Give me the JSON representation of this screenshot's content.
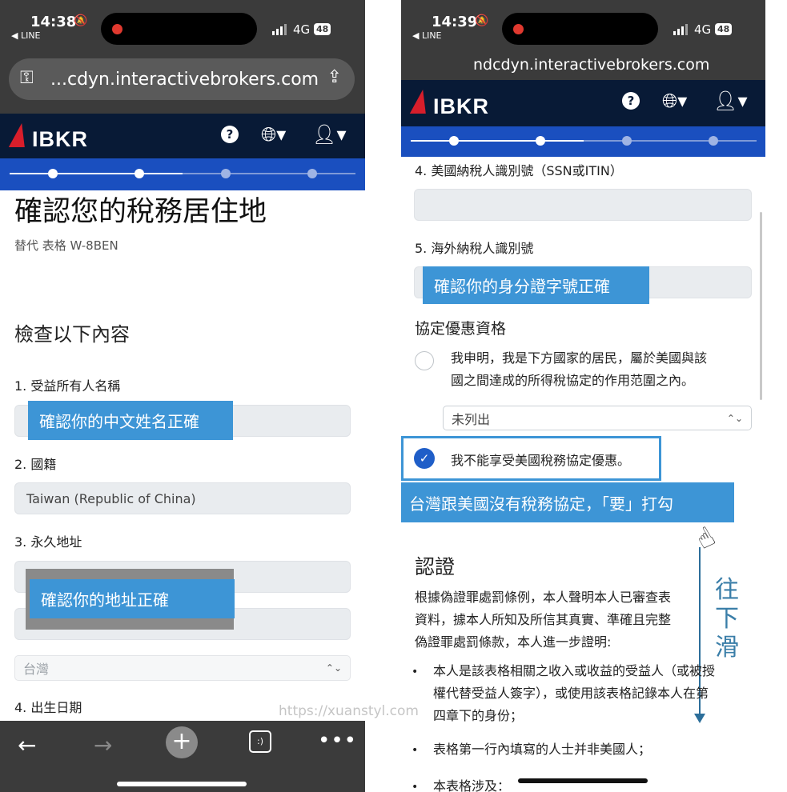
{
  "left": {
    "status": {
      "time": "14:38",
      "back_app": "◀ LINE",
      "network": "4G",
      "battery": "48"
    },
    "url": "...cdyn.interactivebrokers.com",
    "brand": "IBKR",
    "page_title": "確認您的稅務居住地",
    "page_subtitle": "替代 表格 W-8BEN",
    "section_title": "檢查以下內容",
    "fields": {
      "name_label": "1. 受益所有人名稱",
      "nationality_label": "2. 國籍",
      "nationality_value": "Taiwan (Republic of China)",
      "address_label": "3. 永久地址",
      "country_value": "台灣",
      "dob_label": "4. 出生日期"
    },
    "callouts": {
      "name": "確認你的中文姓名正確",
      "address": "確認你的地址正確"
    }
  },
  "right": {
    "status": {
      "time": "14:39",
      "back_app": "◀ LINE",
      "network": "4G",
      "battery": "48"
    },
    "url": "ndcdyn.interactivebrokers.com",
    "brand": "IBKR",
    "fields": {
      "us_tin_label": "4. 美國納稅人識別號（SSN或ITIN）",
      "foreign_tin_label": "5. 海外納稅人識別號"
    },
    "treaty_title": "協定優惠資格",
    "treaty_option_text": "我申明，我是下方國家的居民，屬於美國與該國之間達成的所得稅協定的作用范圍之內。",
    "treaty_option_line1": "我申明，我是下方國家的居民，屬於美國與該",
    "treaty_option_line2": "國之間達成的所得稅協定的作用范圍之內。",
    "country_select": "未列出",
    "no_treaty_text": "我不能享受美國稅務協定優惠。",
    "callouts": {
      "id_number": "確認你的身分證字號正確",
      "treaty": "台灣跟美國沒有稅務協定，「要」打勾"
    },
    "scroll_hint": "往下滑",
    "cert_title": "認證",
    "cert_para_line1": "根據偽證罪處罰條例，本人聲明本人已審查表",
    "cert_para_line2": "資料，據本人所知及所信其真實、準確且完整",
    "cert_para_line3": "偽證罪處罰條款，本人進一步證明:",
    "bullets": [
      {
        "line1": "本人是該表格相關之收入或收益的受益人（或被授",
        "line2": "權代替受益人簽字），或使用該表格記錄本人在第",
        "line3": "四章下的身份；"
      },
      {
        "line1": "表格第一行內填寫的人士并非美國人；"
      },
      {
        "line1": "本表格涉及："
      }
    ]
  },
  "watermark": "https://xuanstyl.com",
  "colors": {
    "navy": "#081a36",
    "progress_blue": "#1a4fbf",
    "callout_blue": "#3d95d6",
    "logo_red": "#d81e2b",
    "check_blue": "#1f5ec8"
  },
  "progress": {
    "current_step": 2,
    "total_steps": 4
  }
}
